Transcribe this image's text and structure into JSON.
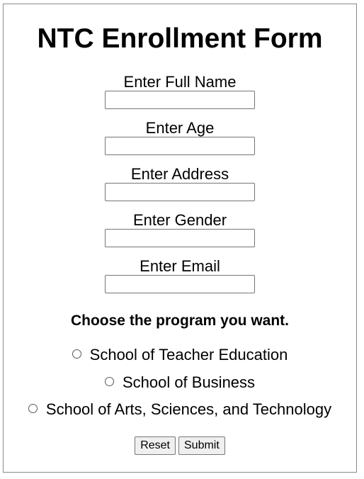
{
  "form": {
    "title": "NTC Enrollment Form",
    "fields": [
      {
        "label": "Enter Full Name",
        "value": "",
        "placeholder": ""
      },
      {
        "label": "Enter Age",
        "value": "",
        "placeholder": ""
      },
      {
        "label": "Enter Address",
        "value": "",
        "placeholder": ""
      },
      {
        "label": "Enter Gender",
        "value": "",
        "placeholder": ""
      },
      {
        "label": "Enter Email",
        "value": "",
        "placeholder": ""
      }
    ],
    "program_heading": "Choose the program you want.",
    "programs": [
      {
        "label": "School of Teacher Education",
        "selected": false
      },
      {
        "label": "School of Business",
        "selected": false
      },
      {
        "label": "School of Arts, Sciences, and Technology",
        "selected": false
      }
    ],
    "buttons": {
      "reset_label": "Reset",
      "submit_label": "Submit"
    }
  }
}
